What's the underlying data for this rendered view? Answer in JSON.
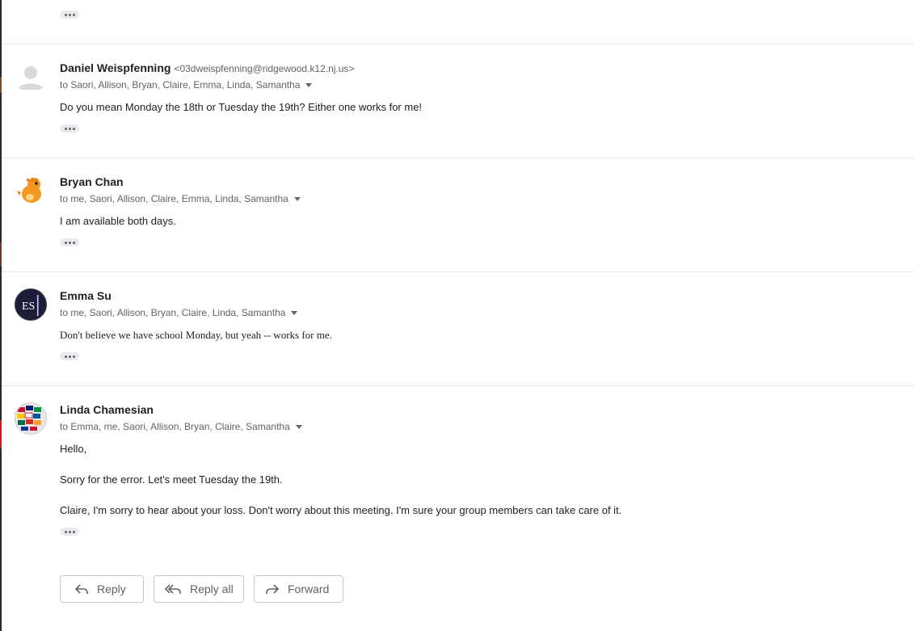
{
  "top": {
    "ellipsis_label": "•••"
  },
  "messages": [
    {
      "sender": "Daniel Weispfenning",
      "email": "<03dweispfenning@ridgewood.k12.nj.us>",
      "recipients": "to Saori, Allison, Bryan, Claire, Emma, Linda, Samantha",
      "body": [
        "Do you mean Monday the 18th or Tuesday the 19th? Either one works for me!"
      ],
      "avatar": "default-person-icon"
    },
    {
      "sender": "Bryan Chan",
      "email": "",
      "recipients": "to me, Saori, Allison, Claire, Emma, Linda, Samantha",
      "body": [
        "I am available both days."
      ],
      "avatar": "orange-dinosaur-icon"
    },
    {
      "sender": "Emma Su",
      "email": "",
      "recipients": "to me, Saori, Allison, Bryan, Claire, Linda, Samantha",
      "body": [
        "Don't believe we have school Monday, but yeah -- works for me."
      ],
      "avatar": "es-initials-icon",
      "avatar_text": "ES"
    },
    {
      "sender": "Linda Chamesian",
      "email": "",
      "recipients": "to Emma, me, Saori, Allison, Bryan, Claire, Samantha",
      "body": [
        "Hello,",
        "Sorry for the error. Let's meet Tuesday the 19th.",
        "Claire, I'm sorry to hear about your loss. Don't worry about this meeting. I'm sure your group members can take care of it."
      ],
      "avatar": "flags-globe-icon"
    }
  ],
  "actions": {
    "reply": "Reply",
    "reply_all": "Reply all",
    "forward": "Forward"
  }
}
